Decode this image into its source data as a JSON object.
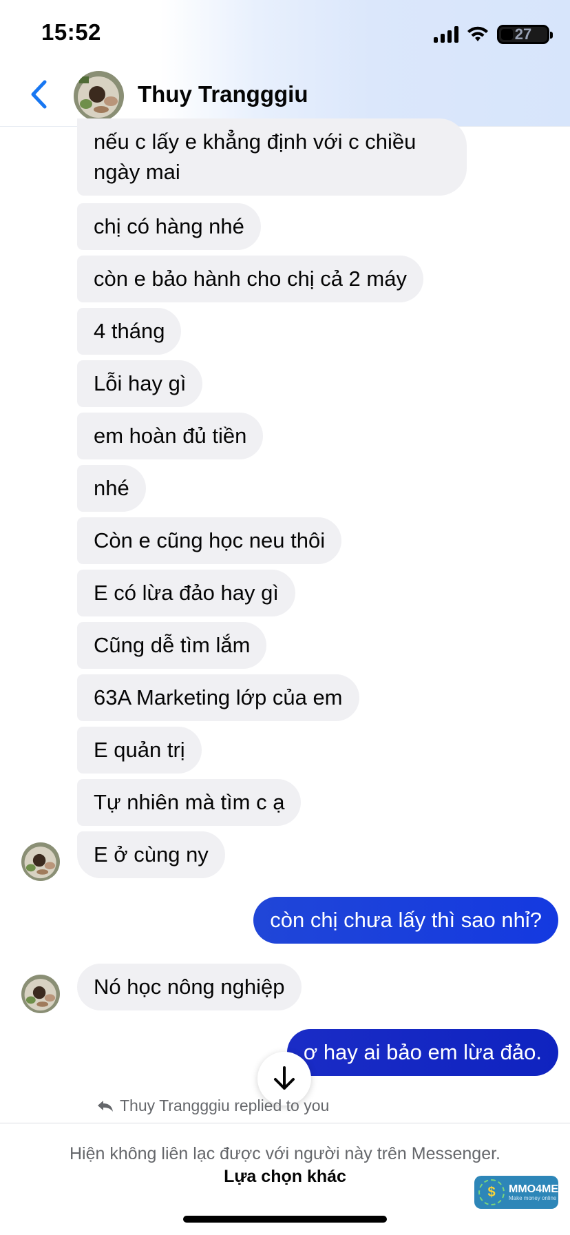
{
  "status": {
    "time": "15:52",
    "battery": "27"
  },
  "header": {
    "contact_name": "Thuy Trangggiu"
  },
  "messages": {
    "m1": "nếu c lấy e khẳng định với c chiều ngày mai",
    "m2": "chị có hàng nhé",
    "m3": "còn e bảo hành cho chị cả 2 máy",
    "m4": "4 tháng",
    "m5": "Lỗi hay gì",
    "m6": "em hoàn đủ tiền",
    "m7": "nhé",
    "m8": "Còn e cũng học neu thôi",
    "m9": "E có lừa đảo hay gì",
    "m10": "Cũng dễ tìm lắm",
    "m11": "63A Marketing lớp của em",
    "m12": "E quản trị",
    "m13": "Tự nhiên mà tìm c ạ",
    "m14": "E ở cùng ny",
    "me1": "còn chị chưa lấy thì sao nhỉ?",
    "m15": "Nó học nông nghiệp",
    "me2": "ơ hay ai bảo em lừa đảo."
  },
  "reply_note": "Thuy Trangggiu replied to you",
  "footer": {
    "notice": "Hiện không liên lạc được với người này trên Messenger.",
    "link": "Lựa chọn khác"
  },
  "watermark": {
    "brand": "MMO4ME",
    "tagline": "Make money online"
  },
  "colors": {
    "accent": "#1877f2",
    "sent_bubble": "#1c3fdc",
    "received_bubble": "#f0f0f3"
  }
}
